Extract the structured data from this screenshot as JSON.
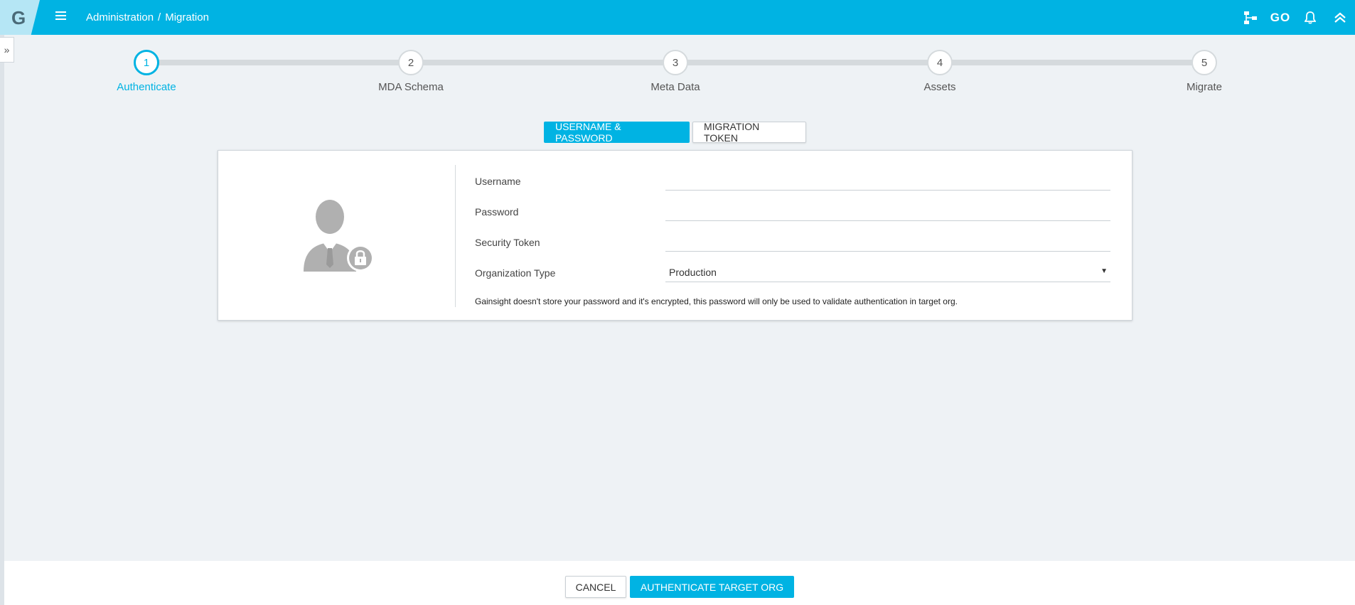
{
  "header": {
    "logo": "G",
    "breadcrumb": [
      "Administration",
      "Migration"
    ],
    "breadcrumb_separator": "/",
    "icons": [
      "org-chart-icon",
      "go-icon",
      "bell-icon",
      "collapse-up-icon"
    ],
    "go_label": "GO",
    "accent_color": "#00b3e3"
  },
  "stepper": {
    "steps": [
      {
        "number": "1",
        "label": "Authenticate",
        "active": true
      },
      {
        "number": "2",
        "label": "MDA Schema",
        "active": false
      },
      {
        "number": "3",
        "label": "Meta Data",
        "active": false
      },
      {
        "number": "4",
        "label": "Assets",
        "active": false
      },
      {
        "number": "5",
        "label": "Migrate",
        "active": false
      }
    ]
  },
  "auth_tabs": {
    "username_password": "USERNAME & PASSWORD",
    "migration_token": "MIGRATION TOKEN",
    "selected": "USERNAME & PASSWORD"
  },
  "form": {
    "username_label": "Username",
    "username_value": "",
    "password_label": "Password",
    "password_value": "",
    "security_token_label": "Security Token",
    "security_token_value": "",
    "org_type_label": "Organization Type",
    "org_type_value": "Production",
    "note": "Gainsight doesn't store your password and it's encrypted, this password will only be used to validate authentication in target org."
  },
  "footer": {
    "cancel_label": "CANCEL",
    "authenticate_label": "AUTHENTICATE TARGET ORG"
  }
}
